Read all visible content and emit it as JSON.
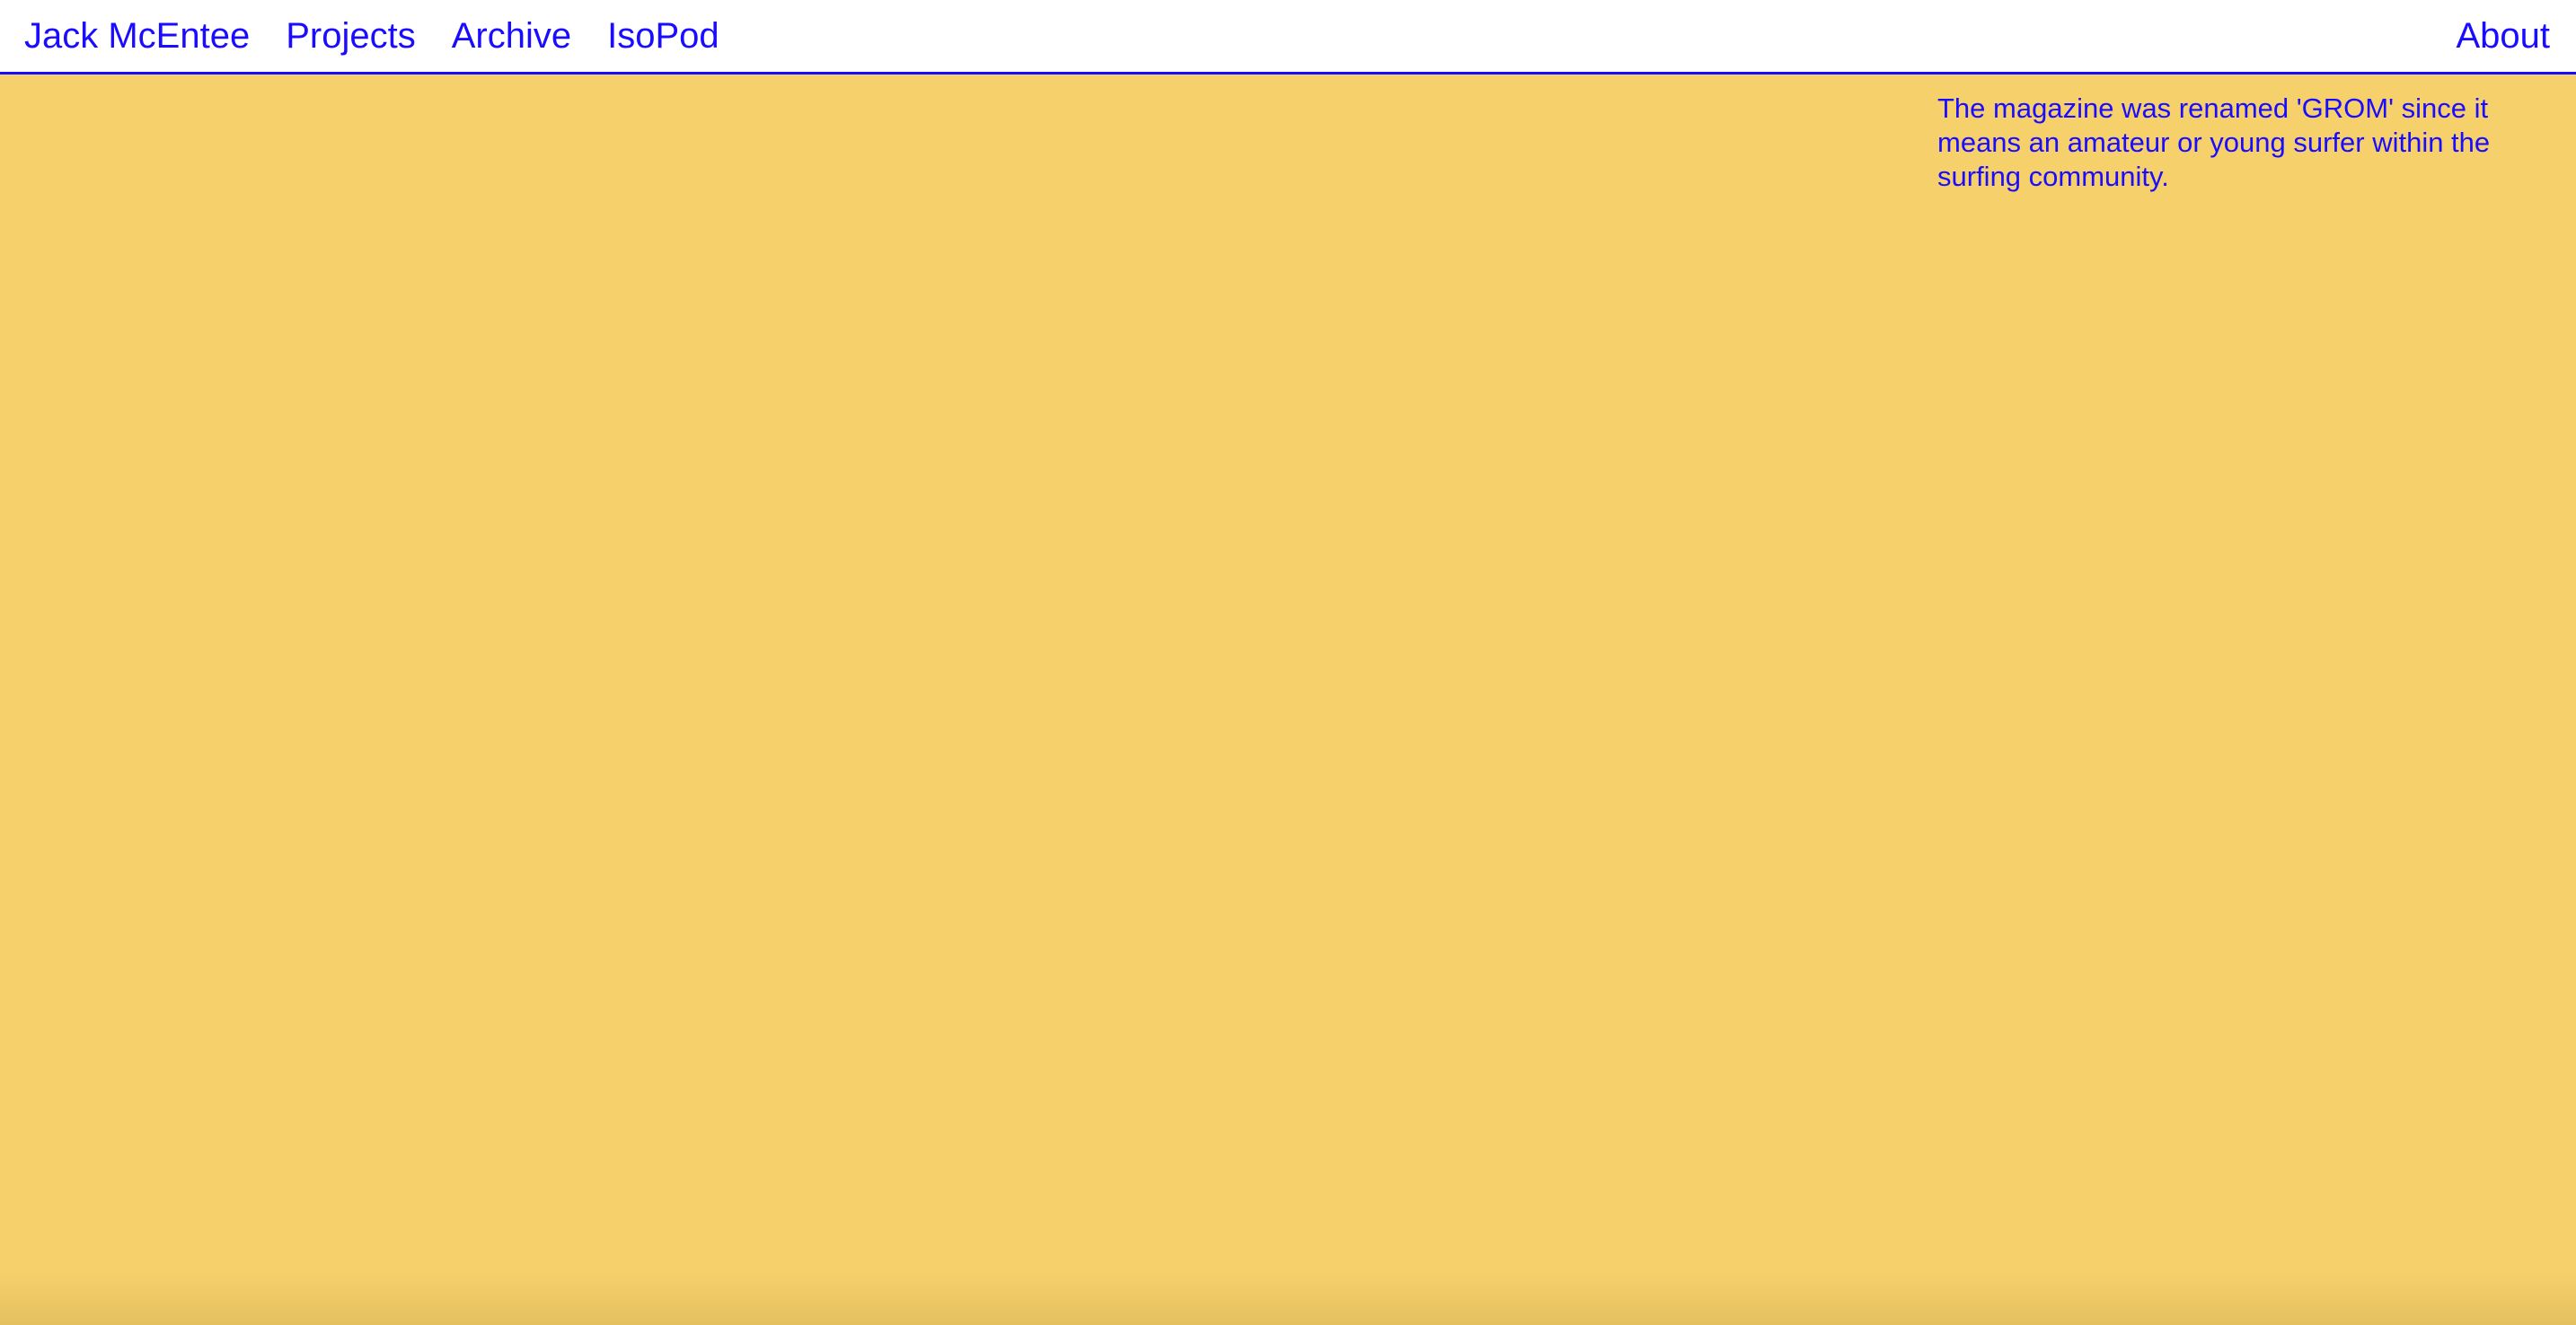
{
  "header": {
    "site_name": "Jack McEntee",
    "nav": [
      {
        "label": "Projects"
      },
      {
        "label": "Archive"
      },
      {
        "label": "IsoPod"
      }
    ],
    "about_label": "About"
  },
  "main": {
    "caption": "The magazine was renamed 'GROM' since it means an amateur or young surfer within the surfing community."
  },
  "colors": {
    "accent": "#1a0dff",
    "background": "#f6d06b",
    "header_bg": "#ffffff"
  }
}
